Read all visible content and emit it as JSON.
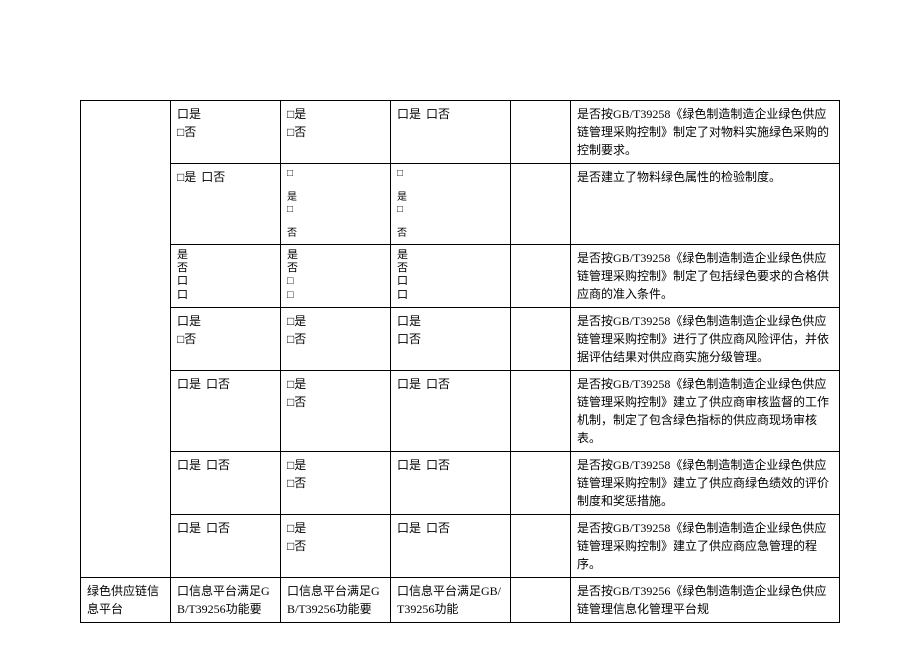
{
  "checkbox": {
    "yes": "是",
    "no": "否",
    "box": "口",
    "alt_box": "□"
  },
  "category": {
    "info_platform": "绿色供应链信息平台"
  },
  "platform_text": {
    "a": "口信息平台满足GB/T39256功能要",
    "b": "口信息平台满足GB/T39256功能要",
    "c": "口信息平台满足GB/T39256功能"
  },
  "rows": [
    {
      "desc": "是否按GB/T39258《绿色制造制造企业绿色供应链管理采购控制》制定了对物料实施绿色采购的控制要求。"
    },
    {
      "desc": "是否建立了物料绿色属性的检验制度。"
    },
    {
      "desc": "是否按GB/T39258《绿色制造制造企业绿色供应链管理采购控制》制定了包括绿色要求的合格供应商的准入条件。"
    },
    {
      "desc": "是否按GB/T39258《绿色制造制造企业绿色供应链管理采购控制》进行了供应商风险评估，并依据评估结果对供应商实施分级管理。"
    },
    {
      "desc": "是否按GB/T39258《绿色制造制造企业绿色供应链管理采购控制》建立了供应商审核监督的工作机制，制定了包含绿色指标的供应商现场审核表。"
    },
    {
      "desc": "是否按GB/T39258《绿色制造制造企业绿色供应链管理采购控制》建立了供应商绿色绩效的评价制度和奖惩措施。"
    },
    {
      "desc": "是否按GB/T39258《绿色制造制造企业绿色供应链管理采购控制》建立了供应商应急管理的程序。"
    },
    {
      "desc": "是否按GB/T39256《绿色制造制造企业绿色供应链管理信息化管理平台规"
    }
  ]
}
